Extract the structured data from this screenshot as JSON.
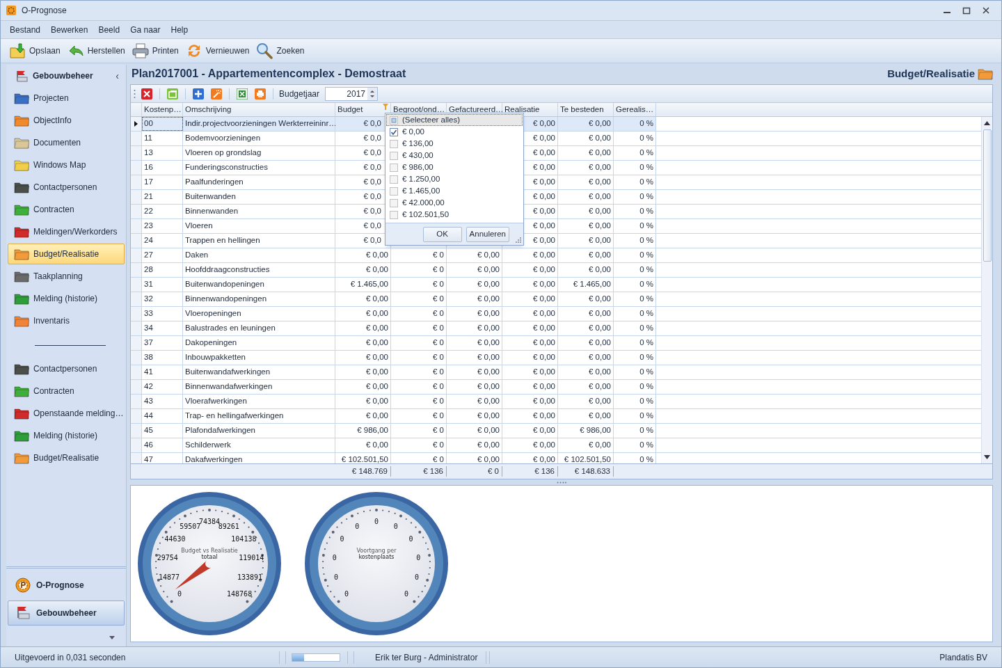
{
  "window": {
    "title": "O-Prognose"
  },
  "menu": [
    "Bestand",
    "Bewerken",
    "Beeld",
    "Ga naar",
    "Help"
  ],
  "toolbar": [
    {
      "label": "Opslaan",
      "kind": "save"
    },
    {
      "label": "Herstellen",
      "kind": "undo"
    },
    {
      "label": "Printen",
      "kind": "print"
    },
    {
      "label": "Vernieuwen",
      "kind": "refresh"
    },
    {
      "label": "Zoeken",
      "kind": "search"
    }
  ],
  "sidebar": {
    "title": "Gebouwbeheer",
    "collapse": "‹",
    "items": [
      {
        "label": "Projecten",
        "color": "#3b6fc4",
        "selected": false
      },
      {
        "label": "ObjectInfo",
        "color": "#f08a2c",
        "selected": false
      },
      {
        "label": "Documenten",
        "color": "#d9c79a",
        "selected": false
      },
      {
        "label": "Windows Map",
        "color": "#f2cf4a",
        "selected": false
      },
      {
        "label": "Contactpersonen",
        "color": "#4a4f4a",
        "selected": false
      },
      {
        "label": "Contracten",
        "color": "#3fae3a",
        "selected": false
      },
      {
        "label": "Meldingen/Werkorders",
        "color": "#d02a2a",
        "selected": false
      },
      {
        "label": "Budget/Realisatie",
        "color": "#f39a3a",
        "selected": true
      },
      {
        "label": "Taakplanning",
        "color": "#6a6a6a",
        "selected": false
      },
      {
        "label": "Melding (historie)",
        "color": "#2f9e3a",
        "selected": false
      },
      {
        "label": "Inventaris",
        "color": "#f0843a",
        "selected": false
      }
    ],
    "secondary_items": [
      {
        "label": "Contactpersonen",
        "color": "#4a4f4a",
        "selected": false
      },
      {
        "label": "Contracten",
        "color": "#3fae3a",
        "selected": false
      },
      {
        "label": "Openstaande melding…",
        "color": "#d02a2a",
        "selected": false
      },
      {
        "label": "Melding (historie)",
        "color": "#2f9e3a",
        "selected": false
      },
      {
        "label": "Budget/Realisatie",
        "color": "#f39a3a",
        "selected": false
      }
    ],
    "modules": [
      {
        "label": "O-Prognose",
        "kind": "prognose",
        "selected": false
      },
      {
        "label": "Gebouwbeheer",
        "kind": "gebouw",
        "selected": true
      }
    ]
  },
  "page": {
    "title": "Plan2017001 - Appartementencomplex - Demostraat",
    "section": "Budget/Realisatie"
  },
  "grid_toolbar": {
    "buttons": [
      {
        "kind": "delete"
      },
      {
        "kind": "window"
      },
      {
        "kind": "add"
      },
      {
        "kind": "wand"
      },
      {
        "kind": "excel"
      },
      {
        "kind": "print"
      }
    ],
    "year_label": "Budgetjaar",
    "year": "2017"
  },
  "table": {
    "columns": [
      {
        "label": "Kostenp…",
        "filtered": false
      },
      {
        "label": "Omschrijving",
        "filtered": false
      },
      {
        "label": "Budget",
        "filtered": true
      },
      {
        "label": "Begroot/ond…",
        "filtered": false
      },
      {
        "label": "Gefactureerd…",
        "filtered": false
      },
      {
        "label": "Realisatie",
        "filtered": false
      },
      {
        "label": "Te besteden",
        "filtered": false
      },
      {
        "label": "Gerealis…",
        "filtered": false
      }
    ],
    "rows": [
      {
        "selected": true,
        "cells": [
          "00",
          "Indir.projectvoorzieningen Werkterreininr…",
          "€ 0,0",
          null,
          null,
          "€ 0,00",
          "€ 0,00",
          "0 %"
        ]
      },
      {
        "selected": false,
        "cells": [
          "11",
          "Bodemvoorzieningen",
          "€ 0,0",
          null,
          null,
          "€ 0,00",
          "€ 0,00",
          "0 %"
        ]
      },
      {
        "selected": false,
        "cells": [
          "13",
          "Vloeren op grondslag",
          "€ 0,0",
          null,
          null,
          "€ 0,00",
          "€ 0,00",
          "0 %"
        ]
      },
      {
        "selected": false,
        "cells": [
          "16",
          "Funderingsconstructies",
          "€ 0,0",
          null,
          null,
          "€ 0,00",
          "€ 0,00",
          "0 %"
        ]
      },
      {
        "selected": false,
        "cells": [
          "17",
          "Paalfunderingen",
          "€ 0,0",
          null,
          null,
          "€ 0,00",
          "€ 0,00",
          "0 %"
        ]
      },
      {
        "selected": false,
        "cells": [
          "21",
          "Buitenwanden",
          "€ 0,0",
          null,
          null,
          "€ 0,00",
          "€ 0,00",
          "0 %"
        ]
      },
      {
        "selected": false,
        "cells": [
          "22",
          "Binnenwanden",
          "€ 0,0",
          null,
          null,
          "€ 0,00",
          "€ 0,00",
          "0 %"
        ]
      },
      {
        "selected": false,
        "cells": [
          "23",
          "Vloeren",
          "€ 0,0",
          null,
          null,
          "€ 0,00",
          "€ 0,00",
          "0 %"
        ]
      },
      {
        "selected": false,
        "cells": [
          "24",
          "Trappen en hellingen",
          "€ 0,0",
          null,
          null,
          "€ 0,00",
          "€ 0,00",
          "0 %"
        ]
      },
      {
        "selected": false,
        "cells": [
          "27",
          "Daken",
          "€ 0,00",
          "€ 0",
          "€ 0,00",
          "€ 0,00",
          "€ 0,00",
          "0 %"
        ]
      },
      {
        "selected": false,
        "cells": [
          "28",
          "Hoofddraagconstructies",
          "€ 0,00",
          "€ 0",
          "€ 0,00",
          "€ 0,00",
          "€ 0,00",
          "0 %"
        ]
      },
      {
        "selected": false,
        "cells": [
          "31",
          "Buitenwandopeningen",
          "€ 1.465,00",
          "€ 0",
          "€ 0,00",
          "€ 0,00",
          "€ 1.465,00",
          "0 %"
        ]
      },
      {
        "selected": false,
        "cells": [
          "32",
          "Binnenwandopeningen",
          "€ 0,00",
          "€ 0",
          "€ 0,00",
          "€ 0,00",
          "€ 0,00",
          "0 %"
        ]
      },
      {
        "selected": false,
        "cells": [
          "33",
          "Vloeropeningen",
          "€ 0,00",
          "€ 0",
          "€ 0,00",
          "€ 0,00",
          "€ 0,00",
          "0 %"
        ]
      },
      {
        "selected": false,
        "cells": [
          "34",
          "Balustrades en leuningen",
          "€ 0,00",
          "€ 0",
          "€ 0,00",
          "€ 0,00",
          "€ 0,00",
          "0 %"
        ]
      },
      {
        "selected": false,
        "cells": [
          "37",
          "Dakopeningen",
          "€ 0,00",
          "€ 0",
          "€ 0,00",
          "€ 0,00",
          "€ 0,00",
          "0 %"
        ]
      },
      {
        "selected": false,
        "cells": [
          "38",
          "Inbouwpakketten",
          "€ 0,00",
          "€ 0",
          "€ 0,00",
          "€ 0,00",
          "€ 0,00",
          "0 %"
        ]
      },
      {
        "selected": false,
        "cells": [
          "41",
          "Buitenwandafwerkingen",
          "€ 0,00",
          "€ 0",
          "€ 0,00",
          "€ 0,00",
          "€ 0,00",
          "0 %"
        ]
      },
      {
        "selected": false,
        "cells": [
          "42",
          "Binnenwandafwerkingen",
          "€ 0,00",
          "€ 0",
          "€ 0,00",
          "€ 0,00",
          "€ 0,00",
          "0 %"
        ]
      },
      {
        "selected": false,
        "cells": [
          "43",
          "Vloerafwerkingen",
          "€ 0,00",
          "€ 0",
          "€ 0,00",
          "€ 0,00",
          "€ 0,00",
          "0 %"
        ]
      },
      {
        "selected": false,
        "cells": [
          "44",
          "Trap- en hellingafwerkingen",
          "€ 0,00",
          "€ 0",
          "€ 0,00",
          "€ 0,00",
          "€ 0,00",
          "0 %"
        ]
      },
      {
        "selected": false,
        "cells": [
          "45",
          "Plafondafwerkingen",
          "€ 986,00",
          "€ 0",
          "€ 0,00",
          "€ 0,00",
          "€ 986,00",
          "0 %"
        ]
      },
      {
        "selected": false,
        "cells": [
          "46",
          "Schilderwerk",
          "€ 0,00",
          "€ 0",
          "€ 0,00",
          "€ 0,00",
          "€ 0,00",
          "0 %"
        ]
      },
      {
        "selected": false,
        "cells": [
          "47",
          "Dakafwerkingen",
          "€ 102.501,50",
          "€ 0",
          "€ 0,00",
          "€ 0,00",
          "€ 102.501,50",
          "0 %"
        ]
      }
    ],
    "totals": [
      "€ 148.769",
      "€ 136",
      "€ 0",
      "€ 136",
      "€ 148.633"
    ]
  },
  "filter_popup": {
    "items": [
      {
        "label": "(Selecteer alles)",
        "checked": false,
        "selected": true
      },
      {
        "label": "€ 0,00",
        "checked": true,
        "selected": false
      },
      {
        "label": "€ 136,00",
        "checked": false,
        "selected": false
      },
      {
        "label": "€ 430,00",
        "checked": false,
        "selected": false
      },
      {
        "label": "€ 986,00",
        "checked": false,
        "selected": false
      },
      {
        "label": "€ 1.250,00",
        "checked": false,
        "selected": false
      },
      {
        "label": "€ 1.465,00",
        "checked": false,
        "selected": false
      },
      {
        "label": "€ 42.000,00",
        "checked": false,
        "selected": false
      },
      {
        "label": "€ 102.501,50",
        "checked": false,
        "selected": false
      }
    ],
    "buttons": [
      "OK",
      "Annuleren"
    ]
  },
  "gauges": [
    {
      "title_lines": [
        "Budget vs Realisatie",
        "totaal"
      ],
      "labels": [
        "74384",
        "59507",
        "89261",
        "44630",
        "104138",
        "29754",
        "119014",
        "14877",
        "133891",
        "0",
        "148768"
      ],
      "needle": true
    },
    {
      "title_lines": [
        "Voortgang per",
        "kostenplaats"
      ],
      "labels": [
        "0",
        "0",
        "0",
        "0",
        "0",
        "0",
        "0",
        "0",
        "0",
        "0",
        "0"
      ],
      "needle": false
    }
  ],
  "status_bar": {
    "message": "Uitgevoerd in 0,031 seconden",
    "progress": {
      "level": 0.25
    },
    "user": "Erik ter Burg - Administrator",
    "company": "Plandatis BV"
  }
}
